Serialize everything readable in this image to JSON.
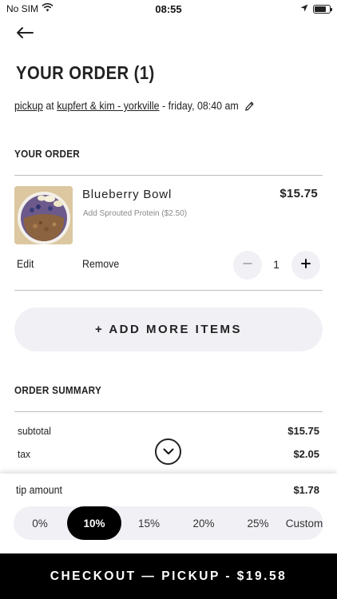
{
  "status_bar": {
    "carrier": "No SIM",
    "time": "08:55",
    "battery_level": 0.8
  },
  "header": {
    "title": "YOUR ORDER (1)"
  },
  "pickup": {
    "mode": "pickup",
    "at": "at",
    "location": "kupfert & kim - yorkville",
    "time_text": "- friday, 08:40 am"
  },
  "order": {
    "section_label": "YOUR ORDER",
    "item": {
      "name": "Blueberry Bowl",
      "modifier": "Add Sprouted Protein ($2.50)",
      "price": "$15.75",
      "quantity": "1",
      "edit_label": "Edit",
      "remove_label": "Remove"
    },
    "add_more_label": "+ ADD MORE ITEMS"
  },
  "summary": {
    "section_label": "ORDER SUMMARY",
    "rows": [
      {
        "label": "subtotal",
        "value": "$15.75"
      },
      {
        "label": "tax",
        "value": "$2.05"
      }
    ]
  },
  "tip": {
    "label": "tip amount",
    "value": "$1.78",
    "options": [
      "0%",
      "10%",
      "15%",
      "20%",
      "25%",
      "Custom"
    ],
    "selected": "10%"
  },
  "checkout": {
    "label": "CHECKOUT — PICKUP - $19.58"
  },
  "icons": {
    "back": "arrow-left-icon",
    "edit_pickup": "pencil-icon",
    "scroll": "chevron-down-icon",
    "minus": "minus-icon",
    "plus": "plus-icon"
  }
}
